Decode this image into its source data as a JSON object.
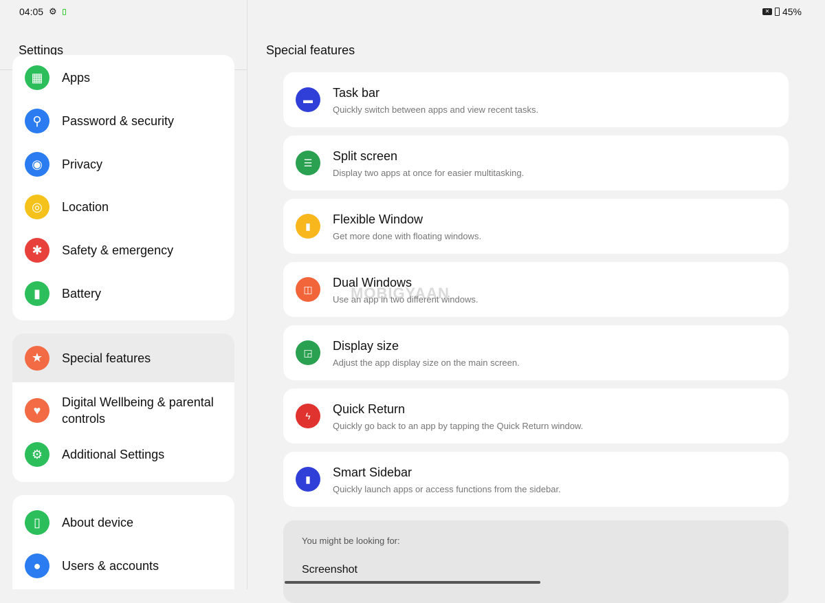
{
  "status_bar": {
    "time": "04:05",
    "battery": "45%"
  },
  "sidebar": {
    "title": "Settings",
    "groups": [
      {
        "items": [
          {
            "label": "Apps",
            "icon": "apps-icon",
            "color": "#2dbe5c"
          },
          {
            "label": "Password & security",
            "icon": "key-icon",
            "color": "#2a7cf0"
          },
          {
            "label": "Privacy",
            "icon": "privacy-eye-icon",
            "color": "#2a7cf0"
          },
          {
            "label": "Location",
            "icon": "location-icon",
            "color": "#f5c21b"
          },
          {
            "label": "Safety & emergency",
            "icon": "asterisk-icon",
            "color": "#e8403a"
          },
          {
            "label": "Battery",
            "icon": "battery-icon",
            "color": "#2dbe5c"
          }
        ]
      },
      {
        "items": [
          {
            "label": "Special features",
            "icon": "star-icon",
            "color": "#f26b45",
            "selected": true
          },
          {
            "label": "Digital Wellbeing & parental controls",
            "icon": "wellbeing-icon",
            "color": "#f26b45"
          },
          {
            "label": "Additional Settings",
            "icon": "gear-icon",
            "color": "#2dbe5c"
          }
        ]
      },
      {
        "items": [
          {
            "label": "About device",
            "icon": "device-icon",
            "color": "#2dbe5c"
          },
          {
            "label": "Users & accounts",
            "icon": "user-icon",
            "color": "#2a7cf0"
          }
        ]
      }
    ]
  },
  "main": {
    "title": "Special features",
    "features": [
      {
        "title": "Task bar",
        "subtitle": "Quickly switch between apps and view recent tasks.",
        "icon": "taskbar-icon",
        "color": "#2f3fd8"
      },
      {
        "title": "Split screen",
        "subtitle": "Display two apps at once for easier multitasking.",
        "icon": "split-screen-icon",
        "color": "#2aa150"
      },
      {
        "title": "Flexible Window",
        "subtitle": "Get more done with floating windows.",
        "icon": "flexible-window-icon",
        "color": "#f7b71d"
      },
      {
        "title": "Dual Windows",
        "subtitle": "Use an app in two different windows.",
        "icon": "dual-windows-icon",
        "color": "#f2643a"
      },
      {
        "title": "Display size",
        "subtitle": "Adjust the app display size on the main screen.",
        "icon": "display-size-icon",
        "color": "#2aa150"
      },
      {
        "title": "Quick Return",
        "subtitle": "Quickly go back to an app by tapping the Quick Return window.",
        "icon": "quick-return-icon",
        "color": "#e0322e"
      },
      {
        "title": "Smart Sidebar",
        "subtitle": "Quickly launch apps or access functions from the sidebar.",
        "icon": "smart-sidebar-icon",
        "color": "#2f3fd8"
      }
    ],
    "suggestions": {
      "heading": "You might be looking for:",
      "items": [
        "Screenshot"
      ]
    }
  },
  "watermark": "MOBIGYAAN"
}
